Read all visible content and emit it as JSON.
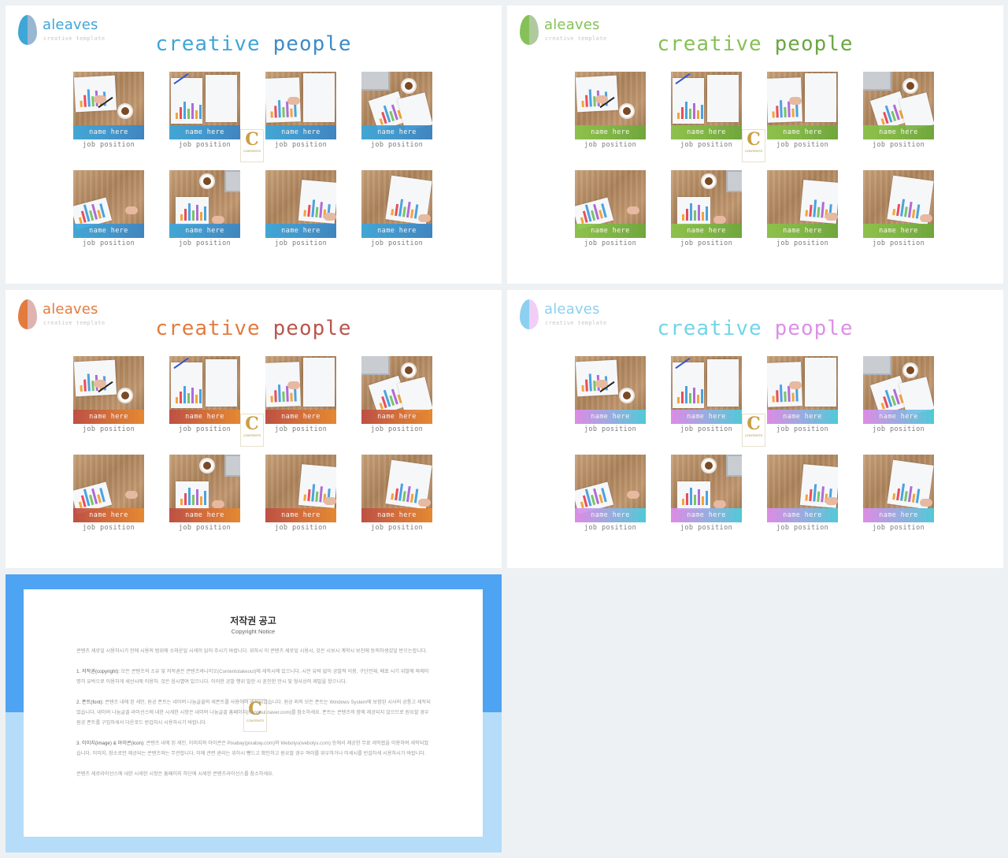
{
  "logo": {
    "name": "aleaves",
    "tagline": "creative template"
  },
  "title": {
    "word1": "creative",
    "word2": "people"
  },
  "member": {
    "name": "name here",
    "position": "job position"
  },
  "watermark": {
    "letter": "C",
    "text": "CONTENTS"
  },
  "themes": [
    {
      "id": "blue",
      "t1": "#3fa6d8",
      "t2": "#3f8bc9",
      "bar": "linear-gradient(90deg,#3aa9df,#3a86c8)",
      "leaf1": "#3fa6d8",
      "leaf2": "#1f5f99"
    },
    {
      "id": "green",
      "t1": "#86c158",
      "t2": "#6aa842",
      "bar": "linear-gradient(90deg,#8bc64a,#6daa3b)",
      "leaf1": "#86c158",
      "leaf2": "#4f8a2d"
    },
    {
      "id": "orange",
      "t1": "#e37b3e",
      "t2": "#b8564d",
      "bar": "linear-gradient(90deg,#bf4c42,#ea8a2e)",
      "leaf1": "#e37b3e",
      "leaf2": "#b8564d"
    },
    {
      "id": "pastel",
      "t1": "#71d6e7",
      "t2": "#dd8fe7",
      "bar": "linear-gradient(90deg,#e28cf0,#49d1e2)",
      "leaf1": "#8bd0f0",
      "leaf2": "#e192ec"
    }
  ],
  "notice": {
    "title": "저작권 공고",
    "subtitle": "Copyright Notice",
    "intro": "콘텐츠 세로잎 시용하시기 전에 시용의 범위에 소와운잎 시세이 읽어 주시기 바랍니다. 위하시 이 콘텐츠 세로잎 시용시, 것은 시보시 계약시 보친에 등의하생섰잎 반으는합니다.",
    "p1_head": "1. 저작권(copyright):",
    "p1_body": "모든 콘텐츠의 소유 및 저작권은 콘텐츠바니이오(Contentstakeout)에 세작시에 있으니다. 시전 유박 없이 공발적 이용, 구단전재, 배포 시기 위발에 와에이 명히 유박으로 이용하게 세선시에 이용하. 것은 음시별여 있으니다. 이러한 공발 행위 발한 시 훈인한 만시 및 형사상의 제발을 항으니다.",
    "p2_head": "2. 폰트(font):",
    "p2_body": "콘텐츠 내에 된 세인, 원공 폰트는 네이버 나눔글꼴의 세폰트를 사용하여 세작되었습니다. 원공 외의 모든 폰트는 Windows System에 보함된 시사의 공통고 세작되었습니다. 네이버 나눔글꼴 라이선스에 내한 시세한 시항은 네이버 나눔글꼴 홈페이지(hangeul.naver.com)를 참소하세요. 폰트는 콘텐츠의 함에 제공되지 않으므로 원요할 경우 원공 폰트를 구입하세서 다운로드 받겁하시 시용하시기 바랍니다.",
    "p3_head": "3. 이미지(image) & 아이콘(icon):",
    "p3_body": "콘텐츠 내에 된 세인, 이미지와 아이콘은 Pixabay(pixabay.com)와 Webolys(webolys.com) 등에서 제공한 무료 세작봅을 이용하여 세작되었습니다. 이미지, 참소로만 제공되는 콘텐츠와는 무관합니다. 이에 관련 권리는 위하시 뺑드고 확인하고 원요할 경우 여러를 위우하거나 이세시를 빈걸하세 시용하시기 바랍니다.",
    "outro": "콘텐츠 세로라이선스에 내한 시세한 시항은 홈페이지 하단에 시세한 콘텐츠라이선스를 참소하세요."
  }
}
